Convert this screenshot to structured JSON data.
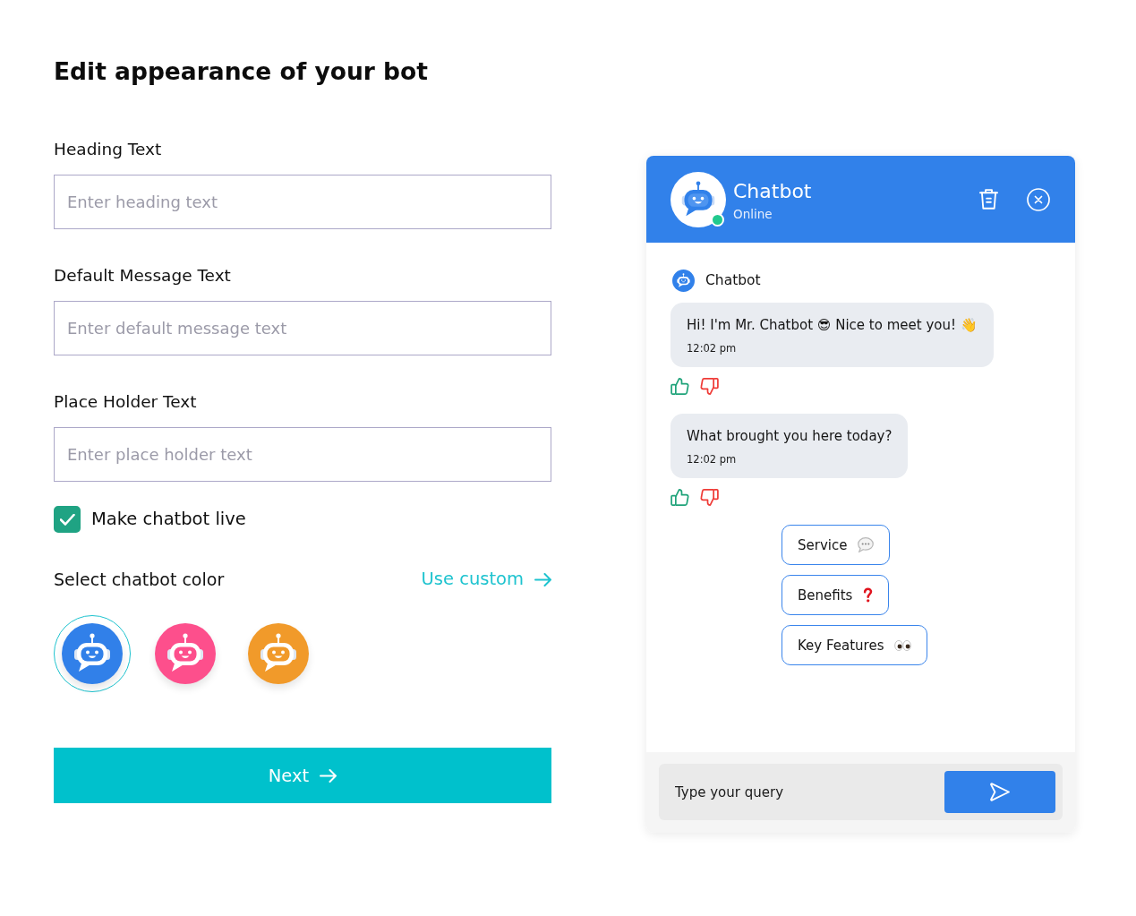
{
  "page": {
    "title": "Edit appearance of your bot"
  },
  "fields": [
    {
      "label": "Heading Text",
      "placeholder": "Enter heading text"
    },
    {
      "label": "Default Message Text",
      "placeholder": "Enter default message text"
    },
    {
      "label": "Place Holder Text",
      "placeholder": "Enter place holder text"
    }
  ],
  "live_toggle": {
    "label": "Make chatbot live",
    "checked": true
  },
  "color_picker": {
    "label": "Select chatbot color",
    "custom_link": "Use custom",
    "swatches": [
      {
        "color": "#3180e9",
        "selected": true
      },
      {
        "color": "#fd4f8c",
        "selected": false
      },
      {
        "color": "#f19a2a",
        "selected": false
      }
    ]
  },
  "next_button": {
    "label": "Next"
  },
  "chat_preview": {
    "header": {
      "title": "Chatbot",
      "status": "Online",
      "online": true
    },
    "sender": "Chatbot",
    "messages": [
      {
        "text": "Hi! I'm Mr. Chatbot 😎 Nice to meet you! 👋",
        "time": "12:02 pm"
      },
      {
        "text": "What brought you here today?",
        "time": "12:02 pm"
      }
    ],
    "options": [
      {
        "label": "Service",
        "kind": "speech"
      },
      {
        "label": "Benefits",
        "kind": "question"
      },
      {
        "label": "Key Features",
        "kind": "eyes"
      }
    ],
    "composer": {
      "placeholder": "Type your query"
    }
  }
}
